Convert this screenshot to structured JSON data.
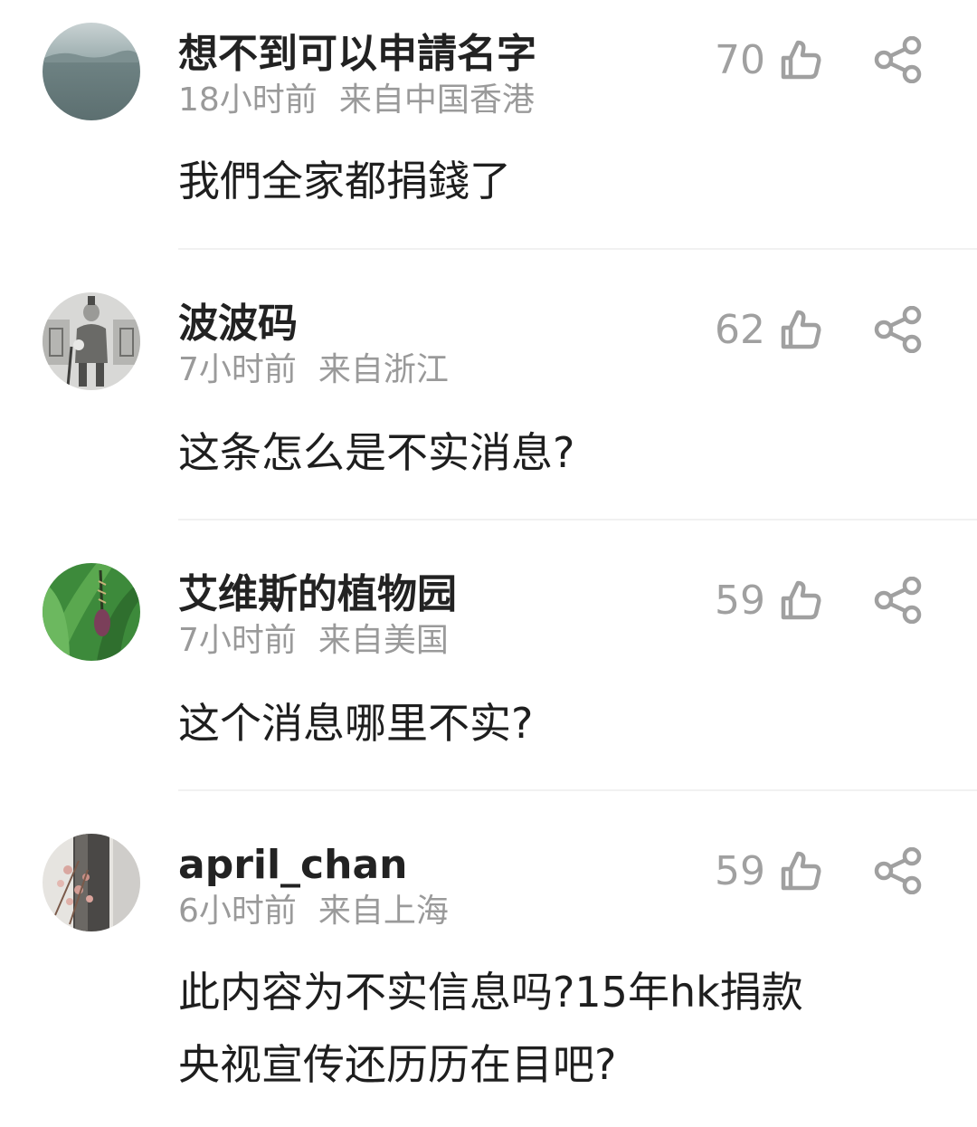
{
  "comments": [
    {
      "username": "想不到可以申請名字",
      "time": "18小时前",
      "location": "来自中国香港",
      "likes": "70",
      "text_lines": [
        "我們全家都捐錢了"
      ]
    },
    {
      "username": "波波码",
      "time": "7小时前",
      "location": "来自浙江",
      "likes": "62",
      "text_lines": [
        "这条怎么是不实消息?"
      ]
    },
    {
      "username": "艾维斯的植物园",
      "time": "7小时前",
      "location": "来自美国",
      "likes": "59",
      "text_lines": [
        "这个消息哪里不实?"
      ]
    },
    {
      "username": "april_chan",
      "time": "6小时前",
      "location": "来自上海",
      "likes": "59",
      "text_lines": [
        "此内容为不实信息吗?15年hk捐款",
        "央视宣传还历历在目吧?"
      ]
    }
  ],
  "icons": {
    "like": "thumbs-up-icon",
    "share": "share-icon"
  },
  "colors": {
    "username": "#222222",
    "meta": "#9a9a9a",
    "body": "#1e1e1e",
    "icon": "#a0a0a0",
    "divider": "#f1f1f1"
  }
}
